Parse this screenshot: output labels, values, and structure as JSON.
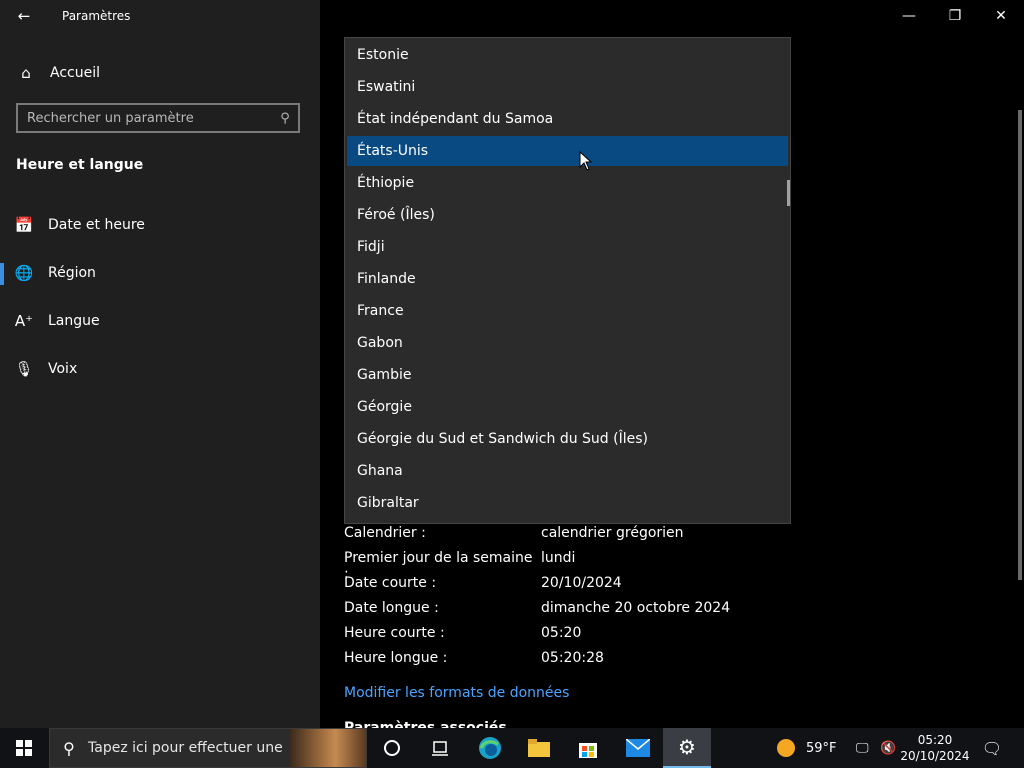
{
  "window": {
    "title": "Paramètres",
    "back_icon": "arrow-left-icon",
    "minimize": "—",
    "maximize": "❐",
    "close": "✕"
  },
  "sidebar": {
    "home_label": "Accueil",
    "search_placeholder": "Rechercher un paramètre",
    "section_title": "Heure et langue",
    "items": [
      {
        "label": "Date et heure",
        "icon": "calendar-clock-icon"
      },
      {
        "label": "Région",
        "icon": "globe-icon",
        "selected": true
      },
      {
        "label": "Langue",
        "icon": "language-icon"
      },
      {
        "label": "Voix",
        "icon": "microphone-icon"
      }
    ]
  },
  "dropdown": {
    "options": [
      "Estonie",
      "Eswatini",
      "État indépendant du Samoa",
      "États-Unis",
      "Éthiopie",
      "Féroé (Îles)",
      "Fidji",
      "Finlande",
      "France",
      "Gabon",
      "Gambie",
      "Géorgie",
      "Géorgie du Sud et Sandwich du Sud (Îles)",
      "Ghana",
      "Gibraltar"
    ],
    "selected_index": 3
  },
  "formats": {
    "rows": [
      {
        "key": "Calendrier :",
        "value": "calendrier grégorien"
      },
      {
        "key": "Premier jour de la semaine :",
        "value": "lundi"
      },
      {
        "key": "Date courte :",
        "value": "20/10/2024"
      },
      {
        "key": "Date longue :",
        "value": "dimanche 20 octobre 2024"
      },
      {
        "key": "Heure courte :",
        "value": "05:20"
      },
      {
        "key": "Heure longue :",
        "value": "05:20:28"
      }
    ],
    "change_link": "Modifier les formats de données",
    "next_heading": "Paramètres associés"
  },
  "taskbar": {
    "search_text": "Tapez ici pour effectuer une",
    "weather": "59°F",
    "time": "05:20",
    "date": "20/10/2024"
  },
  "colors": {
    "selected_option": "#0a4a82",
    "accent": "#3a8fe0",
    "link": "#4da3ff"
  }
}
